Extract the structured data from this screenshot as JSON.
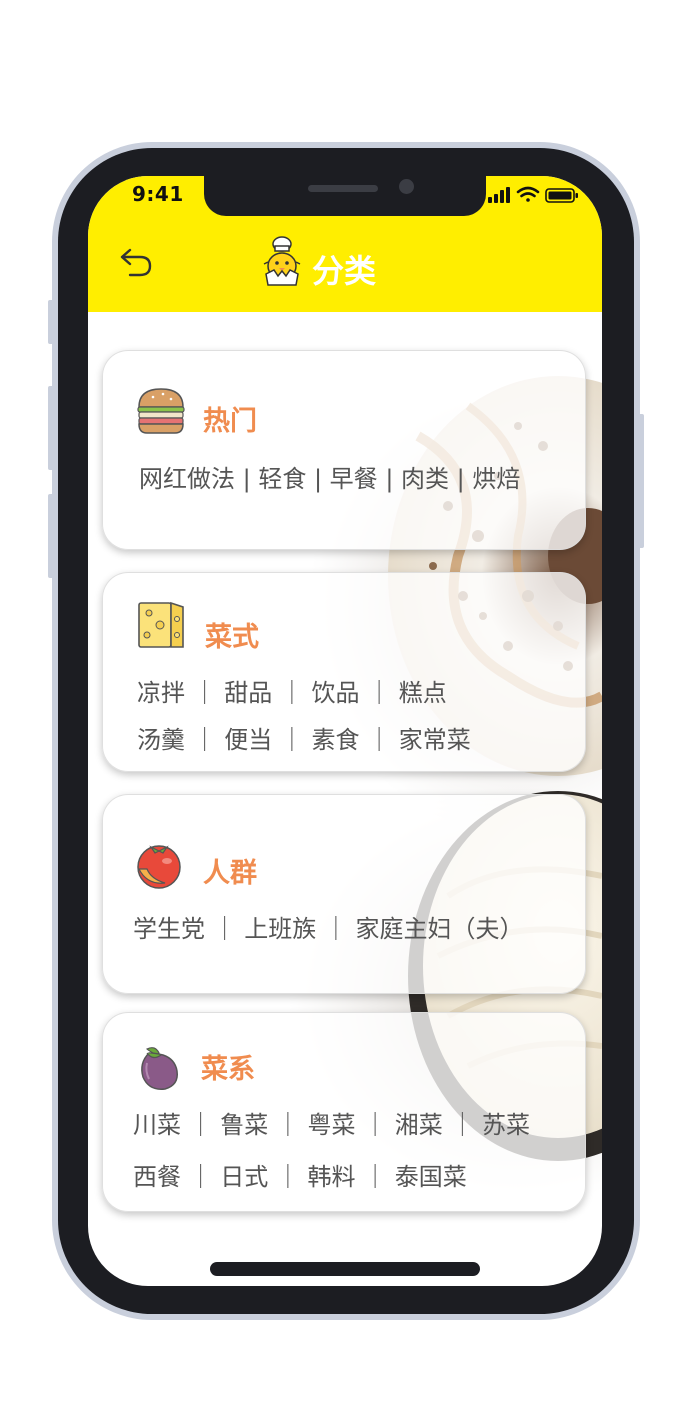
{
  "status": {
    "time": "9:41"
  },
  "header": {
    "title": "分类"
  },
  "cards": [
    {
      "title": "热门",
      "icon": "burger-icon",
      "lines": [
        "网红做法 | 轻食 | 早餐 | 肉类 | 烘焙"
      ]
    },
    {
      "title": "菜式",
      "icon": "cheese-icon",
      "lines": [
        "凉拌 ｜ 甜品 ｜ 饮品 ｜ 糕点",
        "汤羹 ｜ 便当 ｜ 素食 ｜ 家常菜"
      ]
    },
    {
      "title": "人群",
      "icon": "tomato-icon",
      "lines": [
        "学生党 ｜ 上班族 ｜ 家庭主妇（夫）"
      ]
    },
    {
      "title": "菜系",
      "icon": "eggplant-icon",
      "lines": [
        "川菜 ｜ 鲁菜 ｜ 粤菜 ｜ 湘菜 ｜ 苏菜",
        "西餐 ｜ 日式 ｜ 韩料 ｜ 泰国菜"
      ]
    }
  ],
  "colors": {
    "header": "#ffee00",
    "accent": "#f08c4f",
    "text": "#555555"
  }
}
